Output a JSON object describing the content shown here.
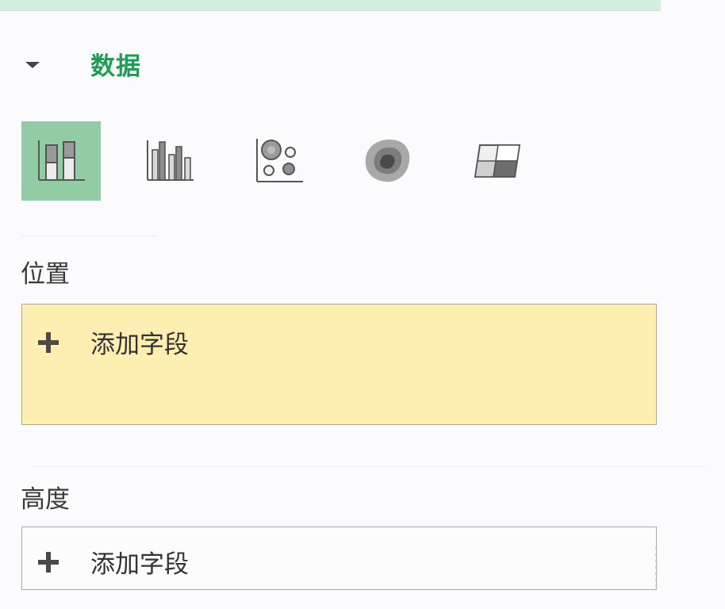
{
  "colors": {
    "accent_green": "#1f9d55",
    "selected_visual_bg": "#92cca5",
    "location_well_bg": "#fdefb2"
  },
  "section": {
    "title": "数据",
    "collapse_icon": "caret-down-icon"
  },
  "visual_types": [
    {
      "icon": "stacked-column-chart-icon",
      "selected": true
    },
    {
      "icon": "clustered-column-chart-icon",
      "selected": false
    },
    {
      "icon": "bubble-chart-icon",
      "selected": false
    },
    {
      "icon": "heat-map-icon",
      "selected": false
    },
    {
      "icon": "region-shading-icon",
      "selected": false
    }
  ],
  "fields": {
    "location": {
      "label": "位置",
      "add_label": "添加字段",
      "icon": "plus-icon"
    },
    "height": {
      "label": "高度",
      "add_label": "添加字段",
      "icon": "plus-icon"
    }
  }
}
